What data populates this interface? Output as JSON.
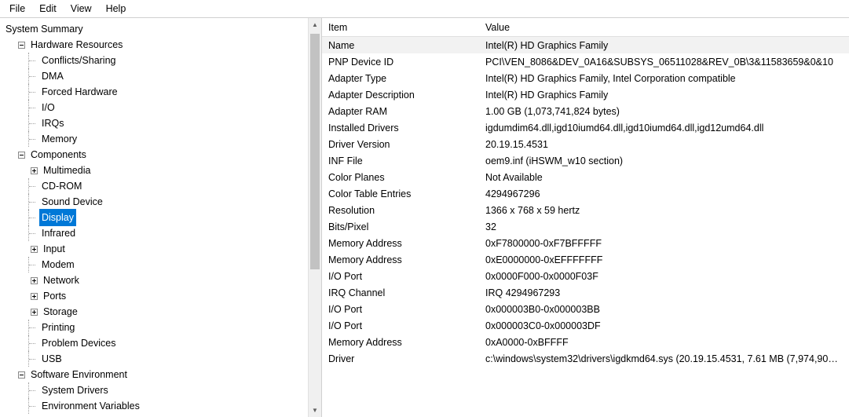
{
  "menu": {
    "file": "File",
    "edit": "Edit",
    "view": "View",
    "help": "Help"
  },
  "tree": {
    "system_summary": "System Summary",
    "hardware_resources": "Hardware Resources",
    "conflicts_sharing": "Conflicts/Sharing",
    "dma": "DMA",
    "forced_hardware": "Forced Hardware",
    "io": "I/O",
    "irqs": "IRQs",
    "memory": "Memory",
    "components": "Components",
    "multimedia": "Multimedia",
    "cd_rom": "CD-ROM",
    "sound_device": "Sound Device",
    "display": "Display",
    "infrared": "Infrared",
    "input": "Input",
    "modem": "Modem",
    "network": "Network",
    "ports": "Ports",
    "storage": "Storage",
    "printing": "Printing",
    "problem_devices": "Problem Devices",
    "usb": "USB",
    "software_environment": "Software Environment",
    "system_drivers": "System Drivers",
    "environment_variables": "Environment Variables"
  },
  "grid": {
    "header_item": "Item",
    "header_value": "Value",
    "rows": [
      {
        "item": "Name",
        "value": "Intel(R) HD Graphics Family"
      },
      {
        "item": "PNP Device ID",
        "value": "PCI\\VEN_8086&DEV_0A16&SUBSYS_06511028&REV_0B\\3&11583659&0&10"
      },
      {
        "item": "Adapter Type",
        "value": "Intel(R) HD Graphics Family, Intel Corporation compatible"
      },
      {
        "item": "Adapter Description",
        "value": "Intel(R) HD Graphics Family"
      },
      {
        "item": "Adapter RAM",
        "value": "1.00 GB (1,073,741,824 bytes)"
      },
      {
        "item": "Installed Drivers",
        "value": "igdumdim64.dll,igd10iumd64.dll,igd10iumd64.dll,igd12umd64.dll"
      },
      {
        "item": "Driver Version",
        "value": "20.19.15.4531"
      },
      {
        "item": "INF File",
        "value": "oem9.inf (iHSWM_w10 section)"
      },
      {
        "item": "Color Planes",
        "value": "Not Available"
      },
      {
        "item": "Color Table Entries",
        "value": "4294967296"
      },
      {
        "item": "Resolution",
        "value": "1366 x 768 x 59 hertz"
      },
      {
        "item": "Bits/Pixel",
        "value": "32"
      },
      {
        "item": "Memory Address",
        "value": "0xF7800000-0xF7BFFFFF"
      },
      {
        "item": "Memory Address",
        "value": "0xE0000000-0xEFFFFFFF"
      },
      {
        "item": "I/O Port",
        "value": "0x0000F000-0x0000F03F"
      },
      {
        "item": "IRQ Channel",
        "value": "IRQ 4294967293"
      },
      {
        "item": "I/O Port",
        "value": "0x000003B0-0x000003BB"
      },
      {
        "item": "I/O Port",
        "value": "0x000003C0-0x000003DF"
      },
      {
        "item": "Memory Address",
        "value": "0xA0000-0xBFFFF"
      },
      {
        "item": "Driver",
        "value": "c:\\windows\\system32\\drivers\\igdkmd64.sys (20.19.15.4531, 7.61 MB (7,974,90…"
      }
    ]
  }
}
